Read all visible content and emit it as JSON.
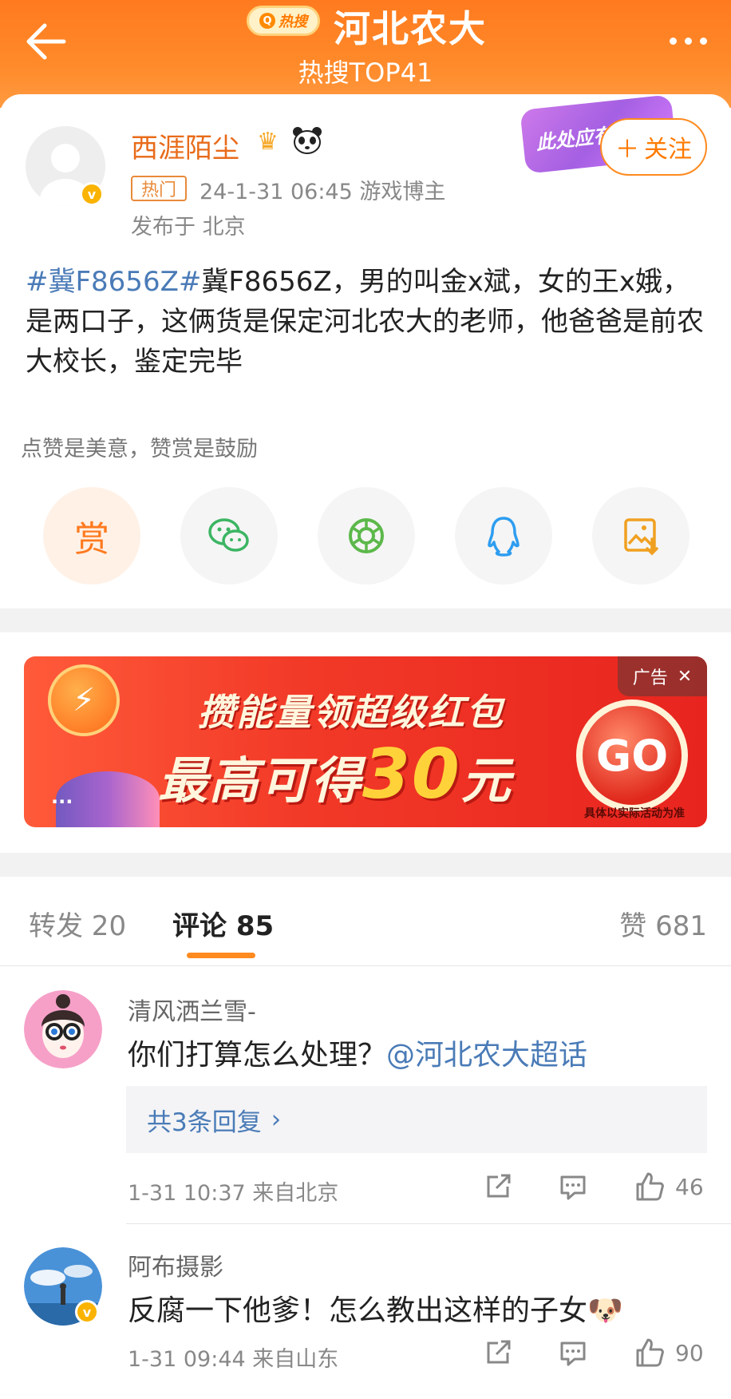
{
  "header": {
    "badge": "热搜",
    "title": "河北农大",
    "subtitle": "热搜TOP41"
  },
  "post": {
    "author": "西涯陌尘",
    "hot_tag": "热门",
    "time_role": "24-1-31 06:45  游戏博主",
    "location": "发布于 北京",
    "promo_sticker": "此处应有",
    "follow_label": "关注",
    "topic": "#冀F8656Z#",
    "body": "冀F8656Z，男的叫金x斌，女的王x娥，是两口子，这俩货是保定河北农大的老师，他爸爸是前农大校长，鉴定完毕",
    "reward_hint": "点赞是美意，赞赏是鼓励",
    "share": [
      {
        "name": "reward",
        "label": "赏"
      },
      {
        "name": "wechat-icon"
      },
      {
        "name": "moments-icon"
      },
      {
        "name": "qq-icon"
      },
      {
        "name": "save-image-icon"
      }
    ],
    "colors": {
      "accent": "#ff8a1f",
      "link": "#4a7bb7",
      "author": "#e86b1a"
    }
  },
  "ad": {
    "line1": "攒能量领超级红包",
    "line2_prefix": "最高可得",
    "amount": "30",
    "unit": "元",
    "go": "GO",
    "note": "具体以实际活动为准",
    "tag": "广告",
    "coin": "⚡",
    "dots": "···"
  },
  "tabs": {
    "repost": "转发 20",
    "comments": "评论 85",
    "likes": "赞 681"
  },
  "comments": [
    {
      "name": "清风洒兰雪-",
      "text": "你们打算怎么处理？",
      "mention": "@河北农大超话",
      "replies": "共3条回复",
      "meta": "1-31 10:37  来自北京",
      "likes": "46"
    },
    {
      "name": "阿布摄影",
      "text": "反腐一下他爹！怎么教出这样的子女🐶",
      "meta": "1-31 09:44  来自山东",
      "likes": "90"
    }
  ]
}
